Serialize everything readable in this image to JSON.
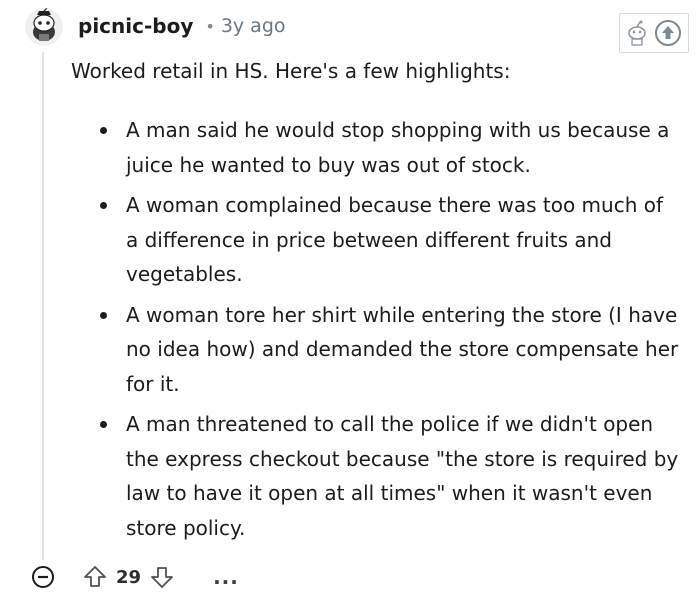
{
  "comment": {
    "username": "picnic-boy",
    "separator": "•",
    "time": "3y ago",
    "intro": "Worked retail in HS. Here's a few highlights:",
    "points": [
      "A man said he would stop shopping with us because a juice he wanted to buy was out of stock.",
      "A woman complained because there was too much of a difference in price between different fruits and vegetables.",
      "A woman tore her shirt while entering the store (I have no idea how) and demanded the store compensate her for it.",
      "A man threatened to call the police if we didn't open the express checkout because \"the store is required by law to have it open at all times\" when it wasn't even store policy."
    ],
    "vote_count": "29",
    "more_label": "..."
  },
  "icons": {
    "avatar": "snoo-avatar-icon",
    "award": "snoo-award-icon",
    "upvote_badge": "upvote-circle-icon",
    "collapse": "collapse-minus-icon",
    "upvote": "upvote-arrow-icon",
    "downvote": "downvote-arrow-icon"
  },
  "colors": {
    "text": "#1c1c1c",
    "muted": "#6a7883",
    "thread_line": "#e0e4e8"
  }
}
